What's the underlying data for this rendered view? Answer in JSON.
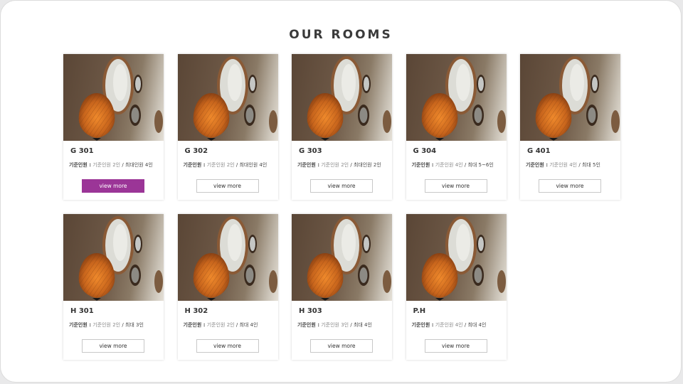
{
  "section": {
    "title": "OUR ROOMS"
  },
  "colors": {
    "accent": "#9b3597",
    "lamp": "#c8651c"
  },
  "image": {
    "icon": "room-photo-lamp-mirror"
  },
  "rooms": [
    {
      "name": "G 301",
      "cap_label": "기준인원 :",
      "cap_base": "기준인원 2인",
      "cap_max": "/ 최대인원 4인",
      "button": "view more",
      "active": true
    },
    {
      "name": "G 302",
      "cap_label": "기준인원 :",
      "cap_base": "기준인원 2인",
      "cap_max": "/ 최대인원 4인",
      "button": "view more",
      "active": false
    },
    {
      "name": "G 303",
      "cap_label": "기준인원 :",
      "cap_base": "기준인원 2인",
      "cap_max": "/ 최대인원 2인",
      "button": "view more",
      "active": false
    },
    {
      "name": "G 304",
      "cap_label": "기준인원 :",
      "cap_base": "기준인원 4인",
      "cap_max": "/ 최대 5~6인",
      "button": "view more",
      "active": false
    },
    {
      "name": "G 401",
      "cap_label": "기준인원 :",
      "cap_base": "기준인원 4인",
      "cap_max": "/ 최대 5인",
      "button": "view more",
      "active": false
    },
    {
      "name": "H 301",
      "cap_label": "기준인원 :",
      "cap_base": "기준인원 2인",
      "cap_max": "/ 최대 3인",
      "button": "view more",
      "active": false
    },
    {
      "name": "H 302",
      "cap_label": "기준인원 :",
      "cap_base": "기준인원 2인",
      "cap_max": "/ 최대 4인",
      "button": "view more",
      "active": false
    },
    {
      "name": "H 303",
      "cap_label": "기준인원 :",
      "cap_base": "기준인원 3인",
      "cap_max": "/ 최대 4인",
      "button": "view more",
      "active": false
    },
    {
      "name": "P.H",
      "cap_label": "기준인원 :",
      "cap_base": "기준인원 4인",
      "cap_max": "/ 최대 4인",
      "button": "view more",
      "active": false
    }
  ]
}
